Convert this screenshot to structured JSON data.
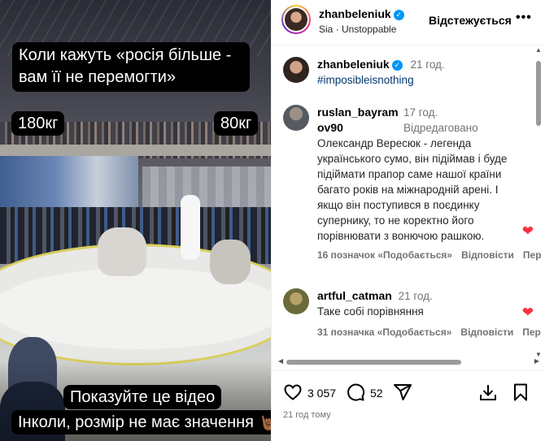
{
  "media": {
    "caption_top": "Коли кажуть «росія більше - вам її не перемогти»",
    "label_left": "180кг",
    "label_right": "80кг",
    "caption_bottom_1": "Показуйте це відео",
    "caption_bottom_2": "Інколи, розмір не має значення 🤘🏾"
  },
  "header": {
    "username": "zhanbeleniuk",
    "follow_label": "Відстежується",
    "more_icon": "more-horizontal-icon",
    "music": "Sia · Unstoppable"
  },
  "comments": [
    {
      "username": "zhanbeleniuk",
      "time": "21 год.",
      "text": "#imposibleisnothing"
    },
    {
      "username_line1": "ruslan_bayram",
      "username_line2": "ov90",
      "time": "17 год.",
      "edited": "Відредаговано",
      "text": "Олександр Вересюк - легенда українського сумо, він підіймав і буде підіймати прапор саме нашої країни багато років на міжнародній арені. І якщо він поступився в поєдинку супернику, то не коректно його порівнювати з вонючою рашкою.",
      "likes": "16 позначок «Подобається»",
      "reply": "Відповісти",
      "more": "Пер"
    },
    {
      "username": "artful_catman",
      "time": "21 год.",
      "text": "Таке собі порівняння",
      "likes": "31 позначка «Подобається»",
      "reply": "Відповісти",
      "more": "Пер"
    }
  ],
  "actions": {
    "likes_count": "3 057",
    "comments_count": "52",
    "posted": "21 год тому"
  },
  "colors": {
    "like_red": "#ff3040",
    "verified_blue": "#0095f6",
    "hashtag_blue": "#00376b"
  }
}
